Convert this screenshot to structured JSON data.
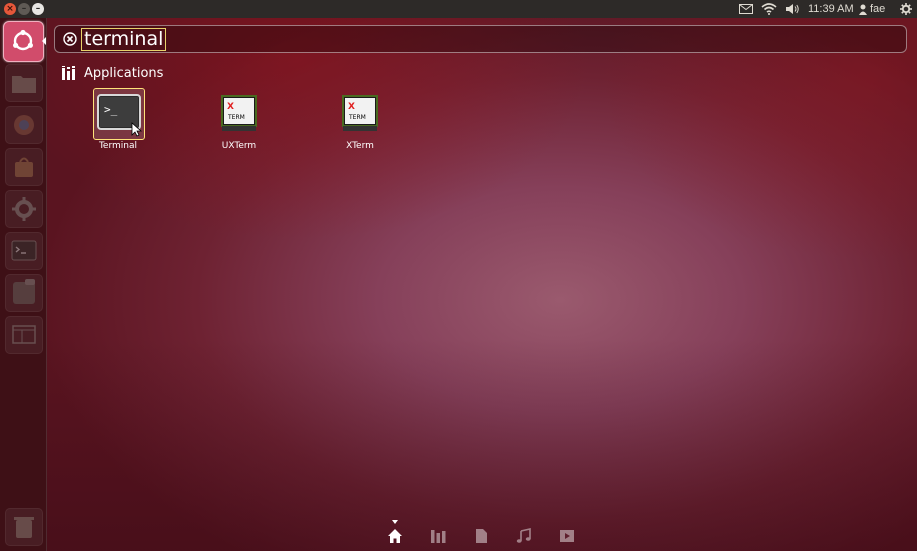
{
  "topbar": {
    "window_controls": [
      "close",
      "minimize",
      "maximize"
    ],
    "time": "11:39 AM",
    "user": "fae",
    "tray_icons": [
      "mail-icon",
      "wifi-icon",
      "sound-icon",
      "user-icon",
      "gear-icon"
    ]
  },
  "launcher": {
    "items": [
      "dash-home",
      "files",
      "firefox",
      "software-center",
      "system-settings",
      "terminal",
      "workspaces",
      "screen-viewer",
      "trash"
    ]
  },
  "search": {
    "query": "terminal"
  },
  "category": {
    "label": "Applications"
  },
  "results": [
    {
      "label": "Terminal",
      "icon": "terminal-icon"
    },
    {
      "label": "UXTerm",
      "icon": "xterm-icon"
    },
    {
      "label": "XTerm",
      "icon": "xterm-icon"
    }
  ],
  "lenses": [
    "home",
    "applications",
    "files",
    "music",
    "video"
  ],
  "colors": {
    "selection_border": "#e8d26a",
    "dash_button": "#d14c6b",
    "panel": "#2d2a28"
  }
}
